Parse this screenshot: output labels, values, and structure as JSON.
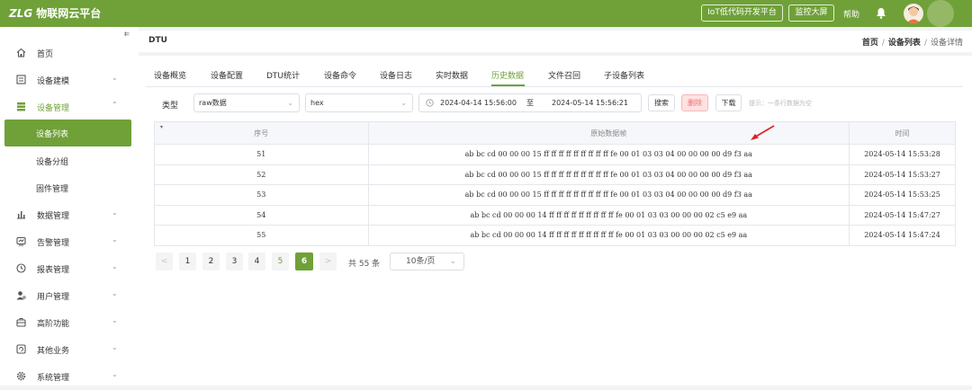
{
  "topbar": {
    "brand_logo": "ZLG",
    "brand_name": "物联网云平台",
    "iot_button": "IoT低代码开发平台",
    "monitor_button": "监控大屏",
    "help": "帮助"
  },
  "sidebar": {
    "collapse": "⇇",
    "items": [
      {
        "label": "首页",
        "icon": "home-icon"
      },
      {
        "label": "设备建模",
        "icon": "model-icon",
        "arrow": "⌄"
      },
      {
        "label": "设备管理",
        "icon": "device-manage-icon",
        "arrow": "⌃"
      },
      {
        "label": "设备列表"
      },
      {
        "label": "设备分组"
      },
      {
        "label": "固件管理"
      },
      {
        "label": "数据管理",
        "icon": "bar-chart-icon",
        "arrow": "⌄"
      },
      {
        "label": "告警管理",
        "icon": "alarm-icon",
        "arrow": "⌄"
      },
      {
        "label": "报表管理",
        "icon": "clock-icon",
        "arrow": "⌄"
      },
      {
        "label": "用户管理",
        "icon": "user-icon",
        "arrow": "⌄"
      },
      {
        "label": "高阶功能",
        "icon": "briefcase-icon",
        "arrow": "⌄"
      },
      {
        "label": "其他业务",
        "icon": "refresh-icon",
        "arrow": "⌄"
      },
      {
        "label": "系统管理",
        "icon": "gear-icon",
        "arrow": "⌄"
      }
    ]
  },
  "header": {
    "title": "DTU",
    "breadcrumb": [
      "首页",
      "设备列表",
      "设备详情"
    ],
    "separator": "/"
  },
  "tabs": [
    "设备概览",
    "设备配置",
    "DTU统计",
    "设备命令",
    "设备日志",
    "实时数据",
    "历史数据",
    "文件召回",
    "子设备列表"
  ],
  "filters": {
    "type_label": "类型",
    "type_value": "raw数据",
    "format_value": "hex",
    "start_date": "2024-04-14 15:56:00",
    "to_label": "至",
    "end_date": "2024-05-14 15:56:21",
    "search_button": "搜索",
    "delete_button": "删除",
    "download_button": "下载",
    "hint": "提示：一条行数据为空"
  },
  "table": {
    "columns": [
      "序号",
      "原始数据帧",
      "时间"
    ],
    "rows": [
      {
        "seq": "51",
        "frame": "ab bc cd 00 00 00 15 ff ff ff ff ff ff ff ff ff fe 00 01 03 03 04 00 00 00 00 d9 f3 aa",
        "time": "2024-05-14 15:53:28"
      },
      {
        "seq": "52",
        "frame": "ab bc cd 00 00 00 15 ff ff ff ff ff ff ff ff ff fe 00 01 03 03 04 00 00 00 00 d9 f3 aa",
        "time": "2024-05-14 15:53:27"
      },
      {
        "seq": "53",
        "frame": "ab bc cd 00 00 00 15 ff ff ff ff ff ff ff ff ff fe 00 01 03 03 04 00 00 00 00 d9 f3 aa",
        "time": "2024-05-14 15:53:25"
      },
      {
        "seq": "54",
        "frame": "ab bc cd 00 00 00 14 ff ff ff ff ff ff ff ff ff fe 00 01 03 03 00 00 00 02 c5 e9 aa",
        "time": "2024-05-14 15:47:27"
      },
      {
        "seq": "55",
        "frame": "ab bc cd 00 00 00 14 ff ff ff ff ff ff ff ff ff fe 00 01 03 03 00 00 00 02 c5 e9 aa",
        "time": "2024-05-14 15:47:24"
      }
    ]
  },
  "pagination": {
    "prev": "<",
    "pages": [
      "1",
      "2",
      "3",
      "4",
      "5",
      "6"
    ],
    "current": "6",
    "next": ">",
    "total": "共 55 条",
    "page_size": "10条/页"
  },
  "colors": {
    "brand": "#6fa138",
    "delete": "#f56c6c",
    "arrow": "#e02020"
  }
}
